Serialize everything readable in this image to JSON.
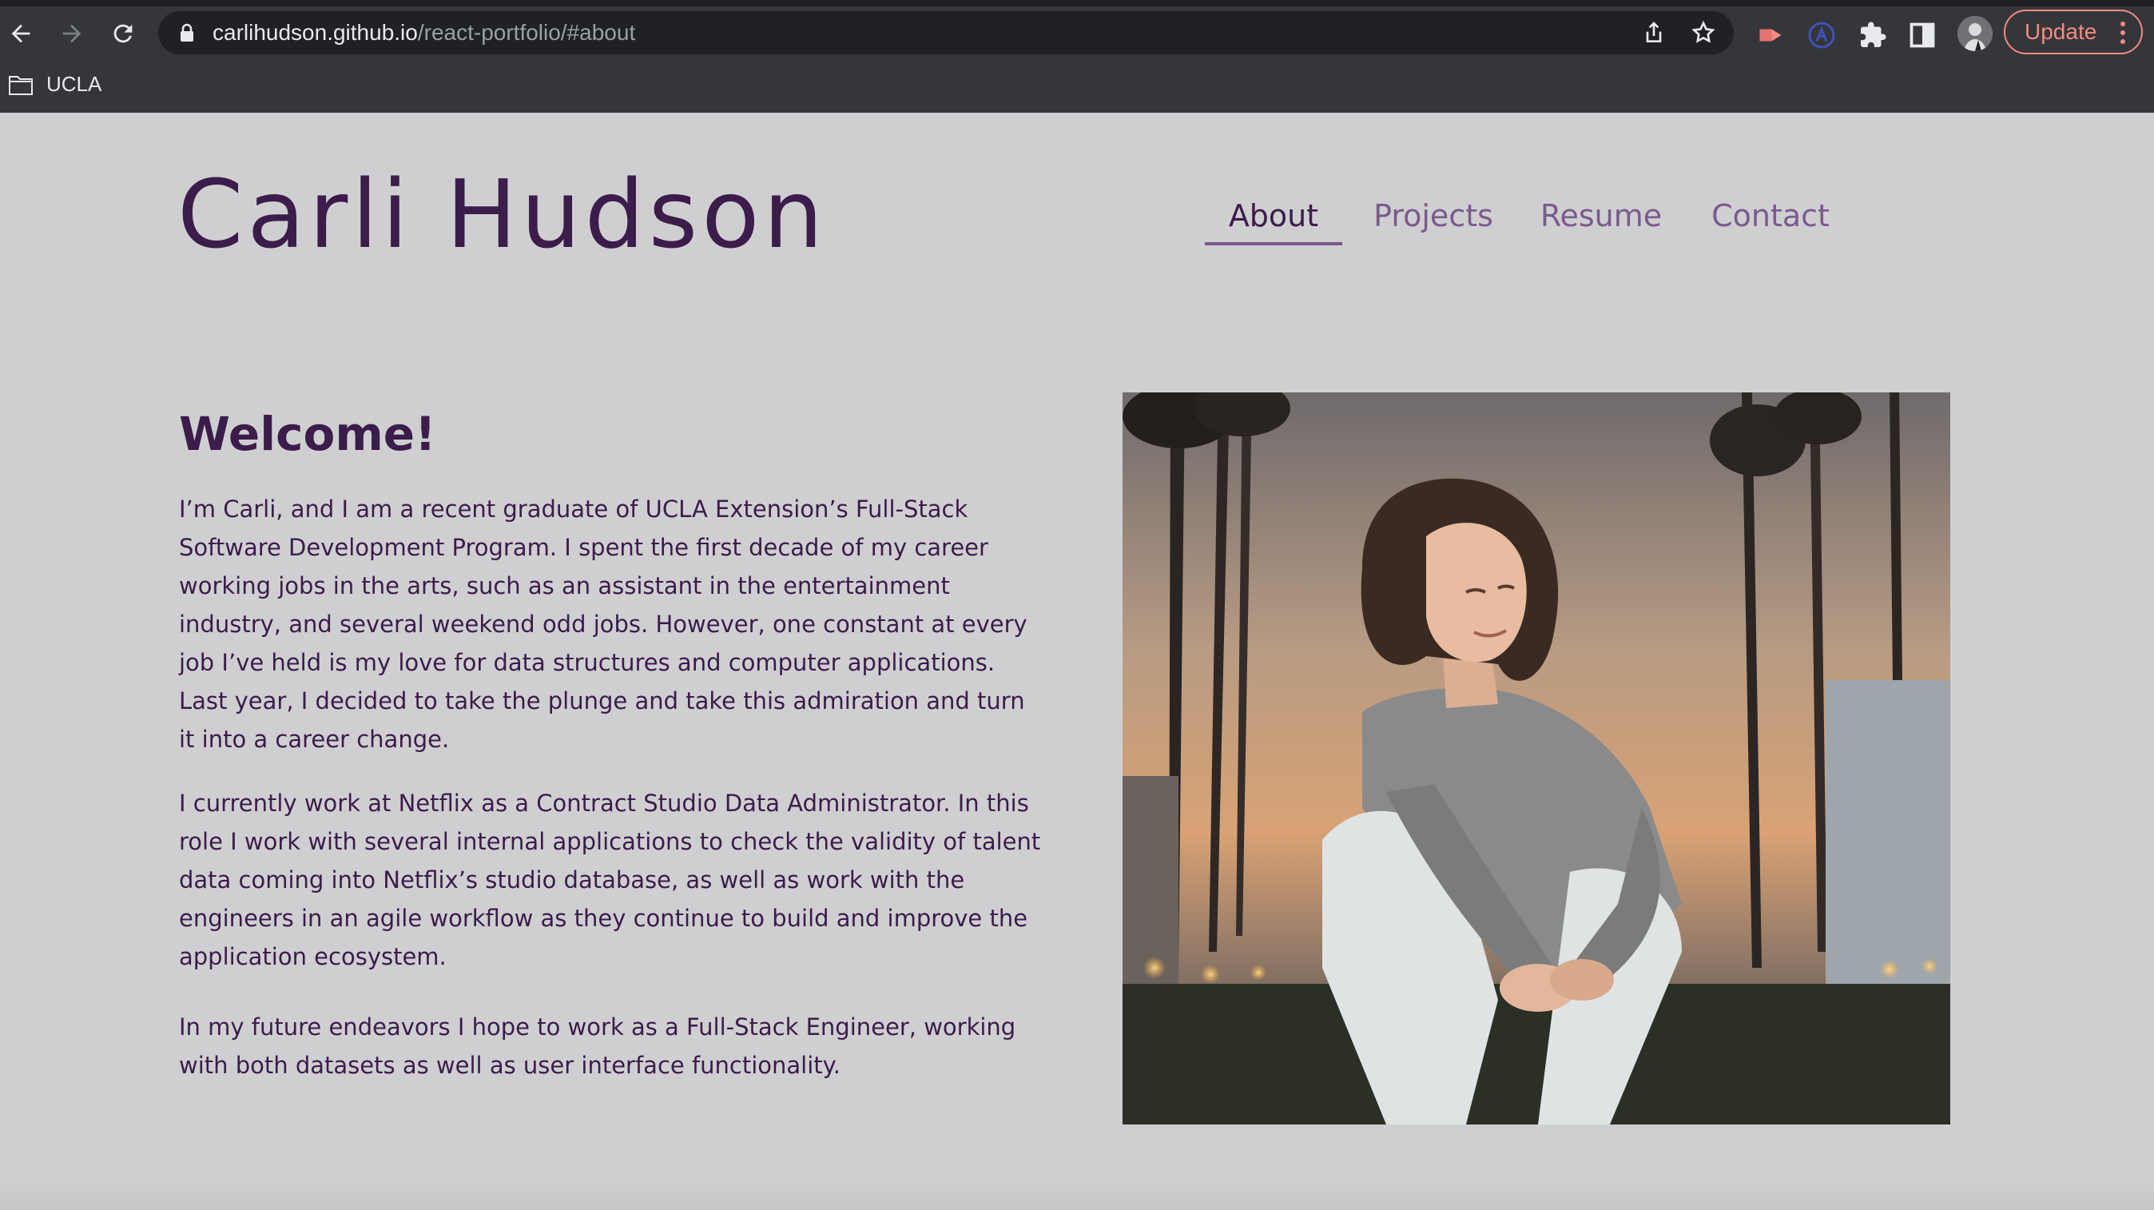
{
  "browser": {
    "url_host": "carlihudson.github.io",
    "url_path": "/react-portfolio/#about",
    "update_label": "Update",
    "bookmarks": [
      {
        "label": "UCLA"
      }
    ],
    "colors": {
      "chrome": "#35363a",
      "omnibox": "#202124",
      "update_accent": "#f28b82"
    }
  },
  "site": {
    "title": "Carli Hudson",
    "nav": [
      {
        "label": "About",
        "active": true
      },
      {
        "label": "Projects",
        "active": false
      },
      {
        "label": "Resume",
        "active": false
      },
      {
        "label": "Contact",
        "active": false
      }
    ],
    "colors": {
      "background": "#cfcfd1",
      "text": "#3b1c4a",
      "nav_inactive": "#7a5a8c"
    }
  },
  "about": {
    "heading": "Welcome!",
    "paragraphs": [
      "I’m Carli, and I am a recent graduate of UCLA Extension’s Full-Stack Software Development Program. I spent the first decade of my career working jobs in the arts, such as an assistant in the entertainment industry, and several weekend odd jobs. However, one constant at every job I’ve held is my love for data structures and computer applications. Last year, I decided to take the plunge and take this admiration and turn it into a career change.",
      "I currently work at Netflix as a Contract Studio Data Administrator. In this role I work with several internal applications to check the validity of talent data coming into Netflix’s studio database, as well as work with the engineers in an agile workflow as they continue to build and improve the application ecosystem.",
      "In my future endeavors I hope to work as a Full-Stack Engineer, working with both datasets as well as user interface functionality."
    ]
  }
}
